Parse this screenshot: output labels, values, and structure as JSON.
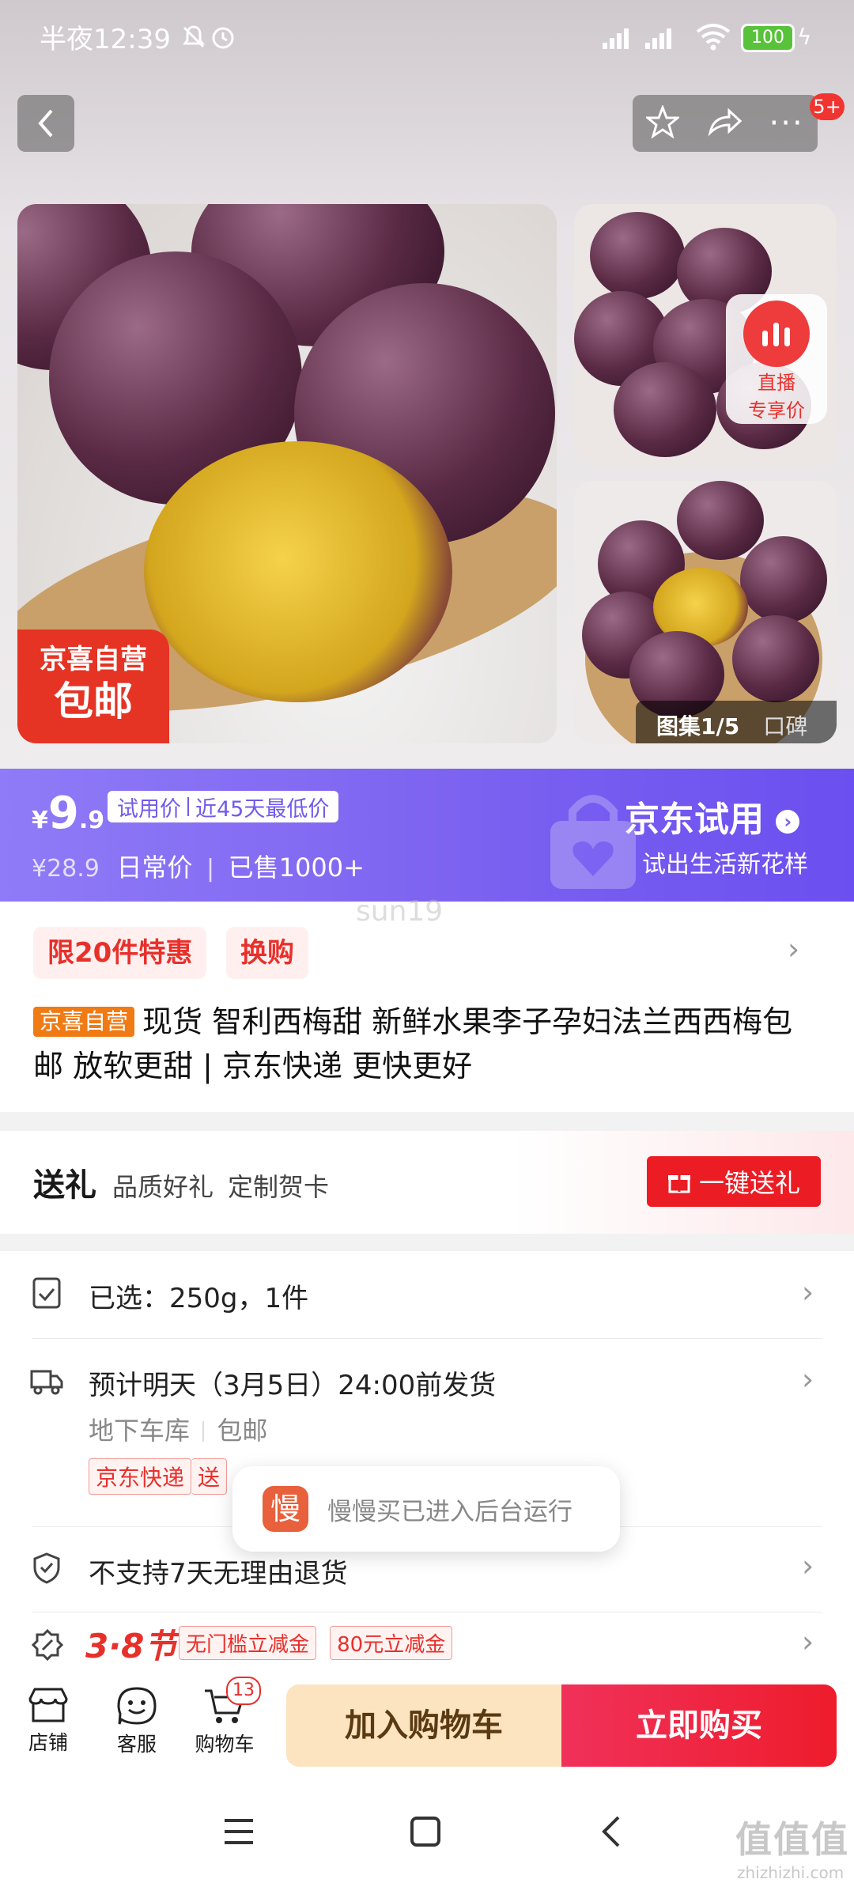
{
  "status_bar": {
    "time": "半夜12:39",
    "battery": "100"
  },
  "header": {
    "badge": "5+"
  },
  "gallery": {
    "seal_line1": "京喜自营",
    "seal_line2": "包邮",
    "live_label1": "直播",
    "live_label2": "专享价",
    "album_label": "图集1/5",
    "review_label": "口碑"
  },
  "price": {
    "currency": "¥",
    "integer": "9",
    "decimal": ".9",
    "trial_tag": "试用价",
    "lowest_tag": "近45天最低价",
    "original": "¥28.9",
    "daily_label": "日常价",
    "sold": "已售1000+",
    "brand": "京东试用",
    "slogan": "试出生活新花样",
    "watermark": "sun19"
  },
  "promo": {
    "tag1": "限20件特惠",
    "tag2": "换购"
  },
  "title": {
    "badge": "京喜自营",
    "text": "现货 智利西梅甜 新鲜水果李子孕妇法兰西西梅包邮 放软更甜 | 京东快递 更快更好"
  },
  "gift": {
    "title": "送礼",
    "sub1": "品质好礼",
    "sub2": "定制贺卡",
    "button": "一键送礼"
  },
  "selection": {
    "label": "已选：250g，1件"
  },
  "delivery": {
    "eta": "预计明天（3月5日）24:00前发货",
    "warehouse": "地下车库",
    "shipping": "包邮",
    "tag1": "京东快递",
    "tag2": "送"
  },
  "toast": {
    "icon_char": "慢",
    "text": "慢慢买已进入后台运行"
  },
  "returns": {
    "label": "不支持7天无理由退货"
  },
  "festival": {
    "title": "3·8节",
    "coupon1": "无门槛立减金",
    "coupon2": "80元立减金"
  },
  "bottom_bar": {
    "store": "店铺",
    "service": "客服",
    "cart": "购物车",
    "cart_count": "13",
    "add_cart": "加入购物车",
    "buy_now": "立即购买"
  },
  "watermark": {
    "text": "值值值",
    "domain": "zhizhizhi.com"
  },
  "colors": {
    "jd_red": "#e8302b",
    "purple": "#7c62f0",
    "add_cart_bg": "#fde4c1",
    "buy_now_bg": "#f01f3c"
  }
}
